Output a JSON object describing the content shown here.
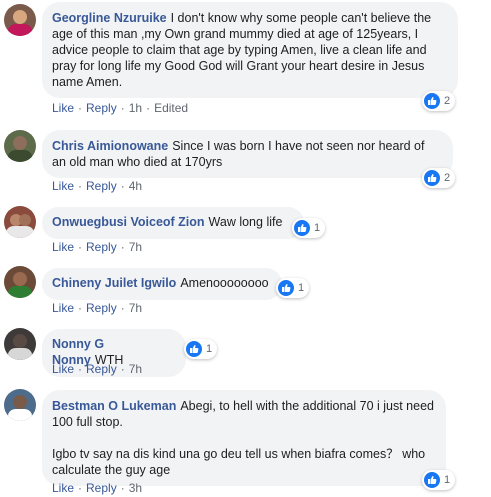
{
  "comments": [
    {
      "author": "Georgline Nzuruike",
      "text": "I don't know why some people can't believe the age of this man ,my Own grand mummy died at age of 125years, I advice people to claim that age by typing Amen, live a clean life and pray for long life my Good God will Grant your heart desire in Jesus name Amen.",
      "like": "Like",
      "reply": "Reply",
      "time": "1h",
      "edited": "Edited",
      "reactions": "2",
      "avatar_color": "#7a5a4a"
    },
    {
      "author": "Chris Aimionowane",
      "text": "Since I was born I have not seen nor heard of an old man who died at 170yrs",
      "like": "Like",
      "reply": "Reply",
      "time": "4h",
      "reactions": "2",
      "avatar_color": "#5d6b4a"
    },
    {
      "author": "Onwuegbusi Voiceof Zion",
      "text": "Waw long life",
      "like": "Like",
      "reply": "Reply",
      "time": "7h",
      "reactions": "1",
      "avatar_color": "#8a4a3c"
    },
    {
      "author": "Chineny Juilet Igwilo",
      "text": "Amenoooooooo",
      "like": "Like",
      "reply": "Reply",
      "time": "7h",
      "reactions": "1",
      "avatar_color": "#6b4a38"
    },
    {
      "author": "Nonny G Nonny",
      "text": "WTH",
      "like": "Like",
      "reply": "Reply",
      "time": "7h",
      "reactions": "1",
      "avatar_color": "#3e3a3a"
    },
    {
      "author": "Bestman O Lukeman",
      "text": "Abegi, to hell with the additional 70 i just need 100 full stop.\n\nIgbo tv say na dis kind una go deu tell us when biafra comes？ who calculate the guy age",
      "like": "Like",
      "reply": "Reply",
      "time": "3h",
      "reactions": "1",
      "avatar_color": "#4d6b8a"
    }
  ],
  "colors": {
    "author": "#385898",
    "bubble": "#f2f3f5",
    "like_badge": "#1877f2"
  }
}
